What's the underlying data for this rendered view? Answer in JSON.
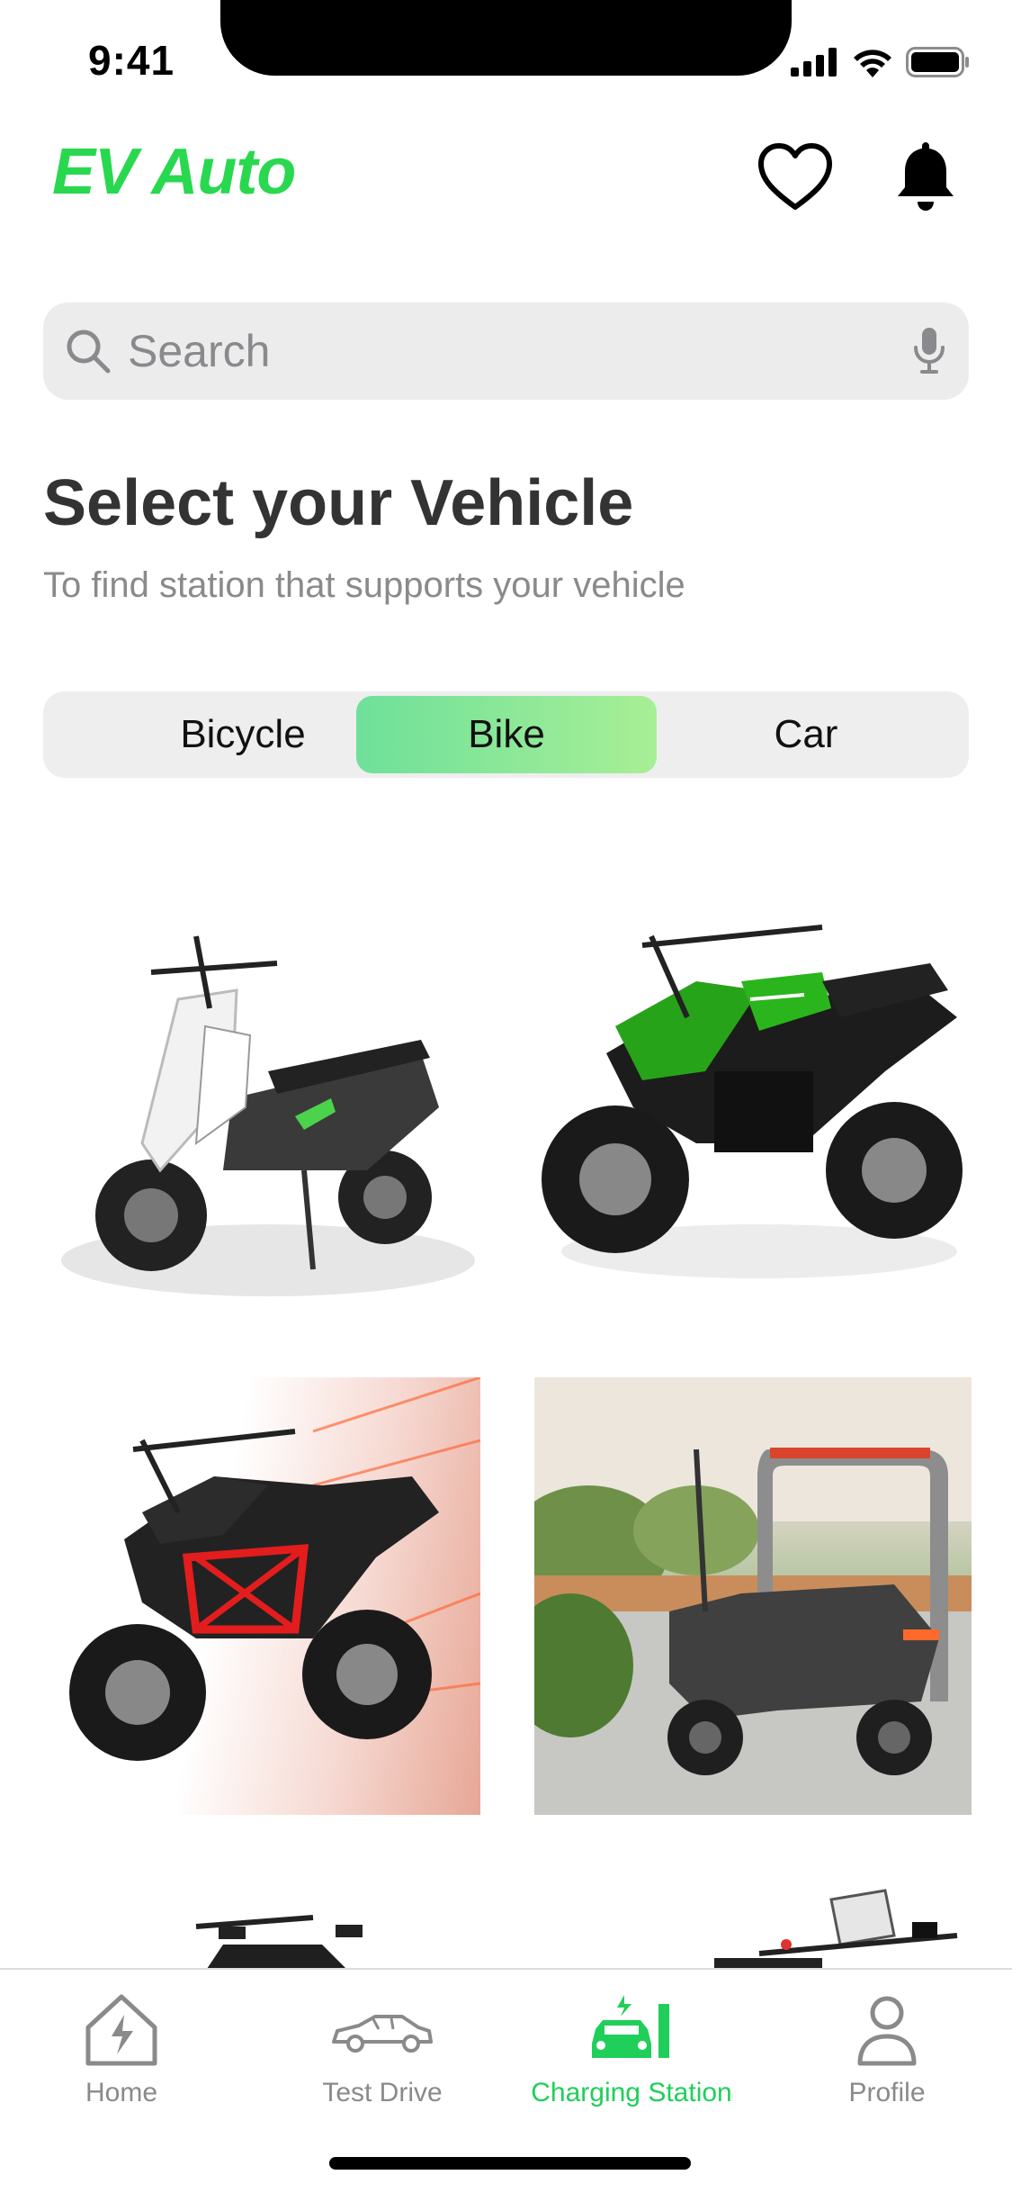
{
  "status_bar": {
    "time": "9:41"
  },
  "header": {
    "brand": "EV Auto",
    "icons": [
      "heart-icon",
      "bell-icon"
    ]
  },
  "search": {
    "placeholder": "Search",
    "value": "",
    "icons": [
      "search-icon",
      "microphone-icon"
    ]
  },
  "section": {
    "title": "Select your Vehicle",
    "subtitle": "To find station that supports your vehicle"
  },
  "segments": {
    "options": [
      "Bicycle",
      "Bike",
      "Car"
    ],
    "selected": "Bike"
  },
  "vehicles": [
    {
      "image": "white-electric-scooter"
    },
    {
      "image": "green-electric-motorcycle"
    },
    {
      "image": "black-red-electric-motorcycle"
    },
    {
      "image": "grey-scooter-at-charging-station"
    },
    {
      "image": "black-motorcycle-partial"
    },
    {
      "image": "touring-motorcycle-partial"
    }
  ],
  "tabbar": {
    "items": [
      {
        "label": "Home",
        "icon": "home-bolt-icon"
      },
      {
        "label": "Test Drive",
        "icon": "car-outline-icon"
      },
      {
        "label": "Charging Station",
        "icon": "charging-car-icon",
        "active": true
      },
      {
        "label": "Profile",
        "icon": "person-icon"
      }
    ]
  },
  "colors": {
    "accent": "#29d84f",
    "segment_gradient_start": "#6ee09a",
    "segment_gradient_end": "#a8ef96",
    "muted_text": "#8a8a8a"
  }
}
